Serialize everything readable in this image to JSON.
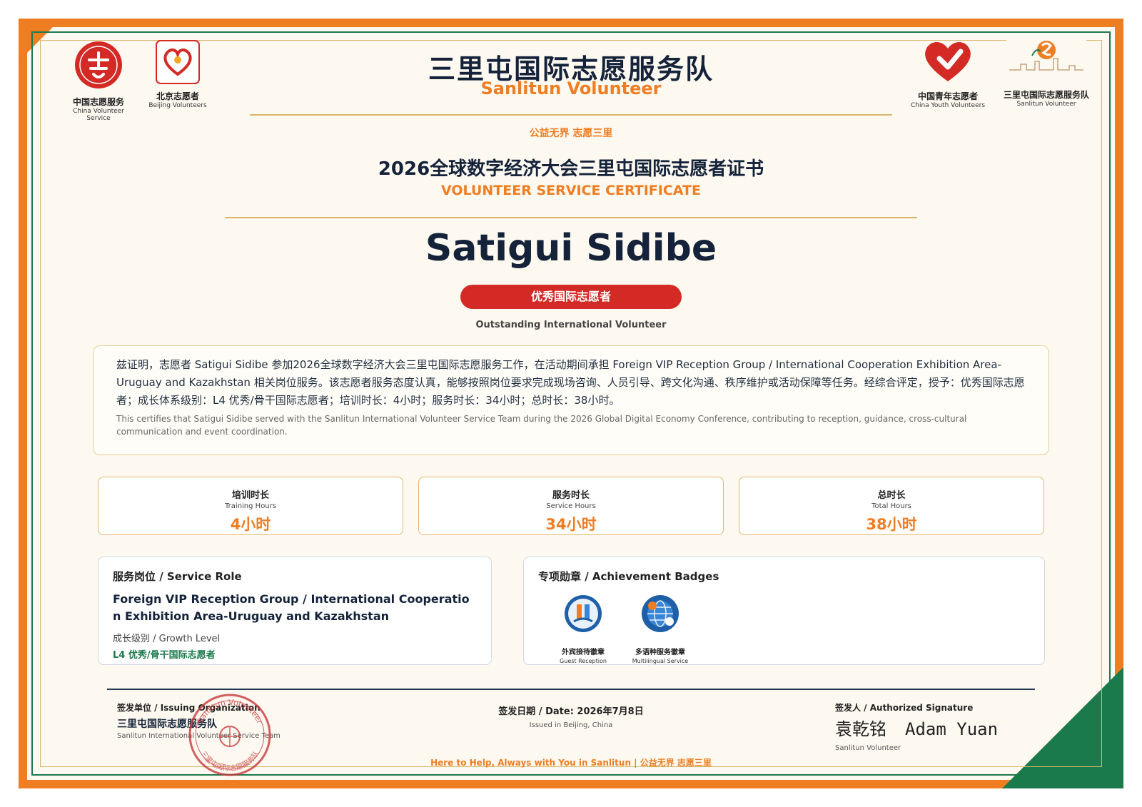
{
  "header": {
    "org_title": "三里屯国际志愿服务队",
    "org_subtitle": "Sanlitun Volunteer",
    "slogan": "公益无界 志愿三里",
    "cert_title": "2026全球数字经济大会三里屯国际志愿者证书",
    "cert_subtitle": "VOLUNTEER SERVICE CERTIFICATE"
  },
  "logos": {
    "left": [
      {
        "icon": "china-volunteer-service-logo",
        "cn": "中国志愿服务",
        "en": "China Volunteer Service",
        "color": "#d42a26"
      },
      {
        "icon": "beijing-volunteers-logo",
        "cn": "北京志愿者",
        "en": "Beijing Volunteers",
        "color": "#d42a26"
      }
    ],
    "right": [
      {
        "icon": "china-youth-volunteers-logo",
        "cn": "中国青年志愿者",
        "en": "China Youth Volunteers",
        "color": "#d42a26"
      },
      {
        "icon": "sanlitun-volunteer-team-logo",
        "cn": "三里屯国际志愿服务队",
        "en": "Sanlitun Volunteer",
        "color": "#ef7d22"
      }
    ]
  },
  "recipient": {
    "name": "Satigui Sidibe",
    "honor_cn": "优秀国际志愿者",
    "honor_en": "Outstanding International Volunteer"
  },
  "statement": {
    "cn": "兹证明，志愿者 Satigui Sidibe 参加2026全球数字经济大会三里屯国际志愿服务工作，在活动期间承担 Foreign VIP Reception Group / International Cooperation Exhibition Area-Uruguay and Kazakhstan 相关岗位服务。该志愿者服务态度认真，能够按照岗位要求完成现场咨询、人员引导、跨文化沟通、秩序维护或活动保障等任务。经综合评定，授予：优秀国际志愿者；成长体系级别：L4 优秀/骨干国际志愿者；培训时长：4小时；服务时长：34小时；总时长：38小时。",
    "en": "This certifies that Satigui Sidibe served with the Sanlitun International Volunteer Service Team during the 2026 Global Digital Economy Conference, contributing to reception, guidance, cross-cultural communication and event coordination."
  },
  "hours": [
    {
      "label_cn": "培训时长",
      "label_en": "Training Hours",
      "value": "4小时"
    },
    {
      "label_cn": "服务时长",
      "label_en": "Service Hours",
      "value": "34小时"
    },
    {
      "label_cn": "总时长",
      "label_en": "Total Hours",
      "value": "38小时"
    }
  ],
  "role_panel": {
    "heading": "服务岗位 / Service Role",
    "role": "Foreign VIP Reception Group / International Cooperation Exhibition Area-Uruguay and Kazakhstan",
    "growth_label": "成长级别 / Growth Level",
    "growth_value": "L4 优秀/骨干国际志愿者"
  },
  "badges_panel": {
    "heading": "专项勋章 / Achievement Badges",
    "badges": [
      {
        "icon": "guest-reception-badge-icon",
        "cn": "外宾接待徽章",
        "en": "Guest Reception"
      },
      {
        "icon": "multilingual-service-badge-icon",
        "cn": "多语种服务徽章",
        "en": "Multilingual Service"
      }
    ]
  },
  "footer": {
    "issuer_label": "签发单位 / Issuing Organization",
    "issuer_cn": "三里屯国际志愿服务队",
    "issuer_en": "Sanlitun International Volunteer Service Team",
    "date_label": "签发日期 / Date: 2026年7月8日",
    "date_place": "Issued in Beijing, China",
    "signer_label": "签发人 / Authorized Signature",
    "signature_cn": "袁乾铭",
    "signature_en": "Adam Yuan",
    "signer_title": "Sanlitun Volunteer",
    "tagline": "Here to Help, Always with You in Sanlitun | 公益无界 志愿三里",
    "seal_text_top": "Sanlitun Volunteer",
    "seal_text_bottom": "三里屯国际志愿服务队"
  },
  "colors": {
    "brand_orange": "#ef7d22",
    "brand_green": "#1a7a4c",
    "navy": "#14223a",
    "honor_red": "#d42a26",
    "gold": "#d8b66a"
  }
}
